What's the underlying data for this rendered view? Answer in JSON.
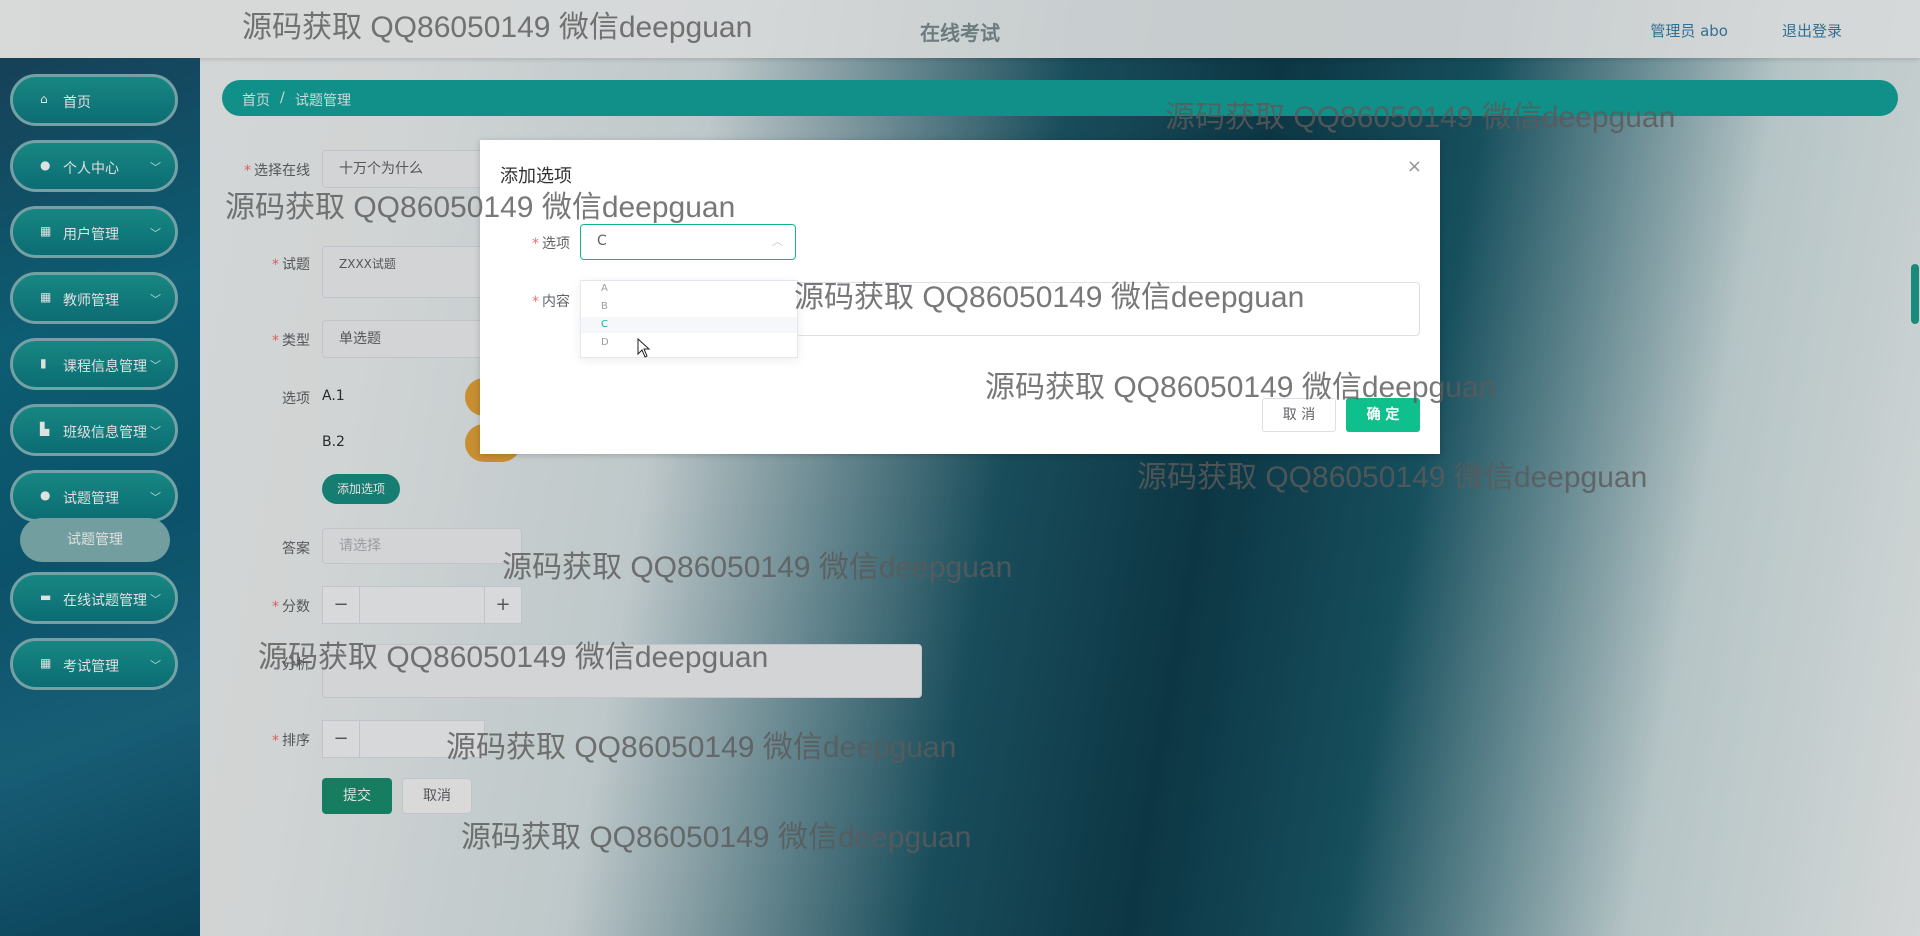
{
  "header": {
    "title": "在线考试",
    "user": "管理员 abo",
    "logout": "退出登录"
  },
  "sidebar": {
    "items": [
      {
        "label": "首页",
        "icon": "home-icon",
        "chevron": false
      },
      {
        "label": "个人中心",
        "icon": "user-icon",
        "chevron": true
      },
      {
        "label": "用户管理",
        "icon": "grid-icon",
        "chevron": true
      },
      {
        "label": "教师管理",
        "icon": "grid-icon",
        "chevron": true
      },
      {
        "label": "课程信息管理",
        "icon": "clipboard-icon",
        "chevron": true
      },
      {
        "label": "班级信息管理",
        "icon": "thumb-icon",
        "chevron": true
      },
      {
        "label": "试题管理",
        "icon": "pin-icon",
        "chevron": true
      },
      {
        "label": "在线试题管理",
        "icon": "card-icon",
        "chevron": true
      },
      {
        "label": "考试管理",
        "icon": "grid-icon",
        "chevron": true
      }
    ],
    "submenu_active": "试题管理"
  },
  "breadcrumb": {
    "home": "首页",
    "sep": "/",
    "current": "试题管理"
  },
  "form": {
    "exam_label": "选择在线",
    "exam_value": "十万个为什么",
    "question_label": "试题",
    "question_value": "ZXXX试题",
    "type_label": "类型",
    "type_value": "单选题",
    "options_label": "选项",
    "option_a": "A.1",
    "option_b": "B.2",
    "add_option_button": "添加选项",
    "answer_label": "答案",
    "answer_placeholder": "请选择",
    "score_label": "分数",
    "analysis_label": "分析",
    "sort_label": "排序",
    "minus": "−",
    "plus": "+",
    "submit": "提交",
    "cancel": "取消"
  },
  "dialog": {
    "title": "添加选项",
    "close": "×",
    "option_label": "选项",
    "option_value": "C",
    "content_label": "内容",
    "dropdown_options": [
      "A",
      "B",
      "C",
      "D"
    ],
    "dropdown_selected": "C",
    "cancel": "取 消",
    "confirm": "确 定"
  },
  "watermark": "源码获取 QQ86050149 微信deepguan"
}
